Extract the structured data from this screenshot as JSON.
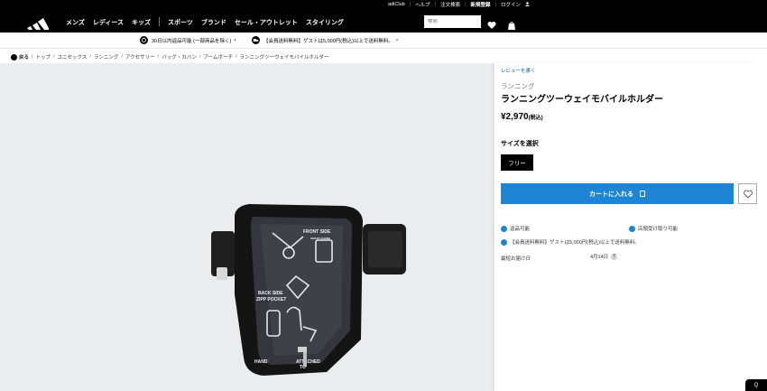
{
  "utility": {
    "items": [
      "adiClub",
      "ヘルプ",
      "注文検索",
      "新規登録",
      "ログイン"
    ]
  },
  "nav": {
    "items": [
      "メンズ",
      "レディース",
      "キッズ",
      "スポーツ",
      "ブランド",
      "セール・アウトレット",
      "スタイリング"
    ],
    "search_placeholder": "検索"
  },
  "promos": [
    "30日以内返品可能 (一部商品を除く)",
    "【会員送料無料】ゲストは5,000円(税込)以上で送料無料。"
  ],
  "breadcrumb": {
    "back": "戻る",
    "items": [
      "トップ",
      "ユニセックス",
      "ランニング",
      "アクセサリー",
      "バッグ・カバン",
      "アームポーチ",
      "ランニングツーウェイモバイルホルダー"
    ]
  },
  "product": {
    "review_link": "レビューを書く",
    "category": "ランニング",
    "name": "ランニングツーウェイモバイルホルダー",
    "price": "¥2,970",
    "price_tax": "(税込)",
    "size_label": "サイズを選択",
    "size_option": "フリー",
    "cart_button": "カートに入れる",
    "image_texts": [
      "FRONT SIDE",
      "SMART PHONE",
      "BACK SIDE",
      "ZIPP POCKET",
      "HAND",
      "ATTACHED",
      "TO"
    ]
  },
  "info": {
    "returns": "返品可能",
    "store_pickup": "店頭受け取り可能",
    "shipping": "【会員送料無料】ゲストは5,000円(税込)以上で送料無料。",
    "delivery_label": "最短お届け日",
    "delivery_date": "4月14日"
  },
  "chat": {
    "label": "Q"
  },
  "colors": {
    "accent": "#1e85d4",
    "gallery_bg": "#ebeced",
    "link": "#0071ae"
  }
}
